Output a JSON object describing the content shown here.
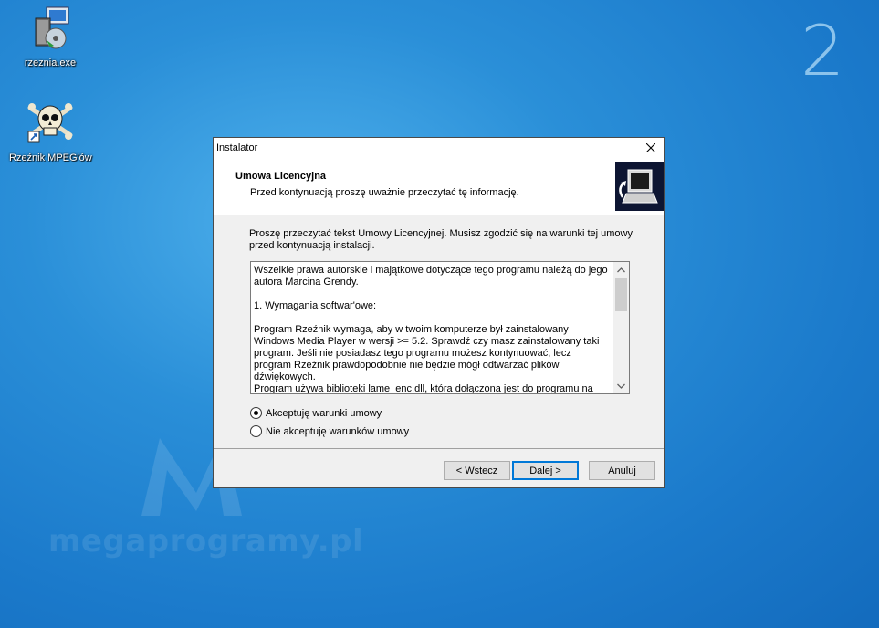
{
  "desktop": {
    "icons": [
      {
        "label": "rzeznia.exe",
        "icon": "installer-icon"
      },
      {
        "label": "Rzeźnik MPEG'ów",
        "icon": "skull-shortcut-icon"
      }
    ],
    "virtual_desktop_number": "2",
    "watermark_text": "megaprogramy.pl"
  },
  "dialog": {
    "title": "Instalator",
    "header_title": "Umowa Licencyjna",
    "header_subtitle": "Przed kontynuacją proszę uważnie przeczytać tę informację.",
    "intro": "Proszę przeczytać tekst Umowy Licencyjnej. Musisz zgodzić się na warunki tej umowy przed kontynuacją instalacji.",
    "license_text": "Wszelkie prawa autorskie i majątkowe dotyczące tego programu należą do jego autora Marcina Grendy.\n\n1. Wymagania softwar'owe:\n\nProgram Rzeźnik wymaga, aby w twoim komputerze był zainstalowany Windows Media Player w wersji >= 5.2. Sprawdź czy masz zainstalowany taki program. Jeśli nie posiadasz tego programu możesz kontynuować, lecz program Rzeźnik prawdopodobnie nie będzie mógł odtwarzać plików dźwiękowych.\nProgram używa biblioteki lame_enc.dll, która dołączona jest do programu na zasadach licencji GNU. Treść tej licencji znajduje się w katalogu, w którym",
    "radio_accept": "Akceptuję warunki umowy",
    "radio_decline": "Nie akceptuję warunków umowy",
    "selected": "accept",
    "buttons": {
      "back": "< Wstecz",
      "next": "Dalej >",
      "cancel": "Anuluj"
    }
  },
  "colors": {
    "accent": "#0078d7",
    "desktop_bg": "#1b7acb"
  }
}
